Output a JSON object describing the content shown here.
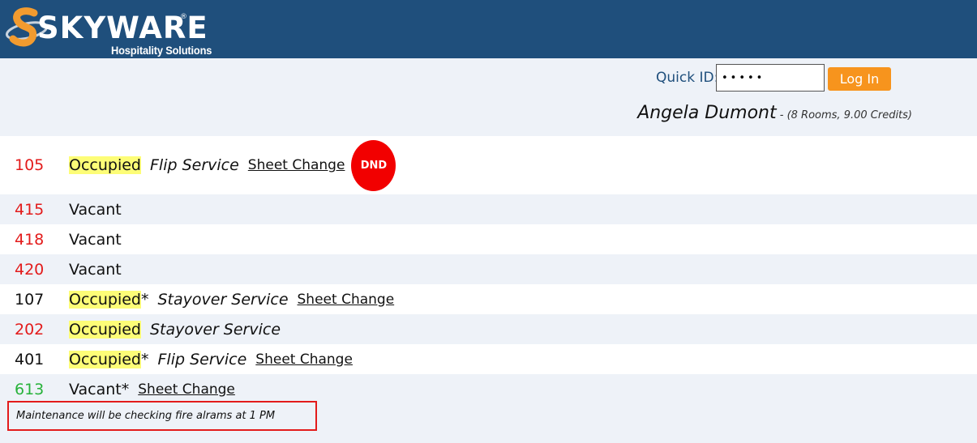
{
  "brand": {
    "name": "SKYWARE",
    "registered": "®",
    "tagline": "Hospitality Solutions",
    "colors": {
      "header": "#1f4f7c",
      "accent": "#f7941d"
    }
  },
  "login": {
    "label": "Quick ID:",
    "value": "•••••",
    "button_label": "Log In"
  },
  "user": {
    "name": "Angela Dumont",
    "meta": " - (8 Rooms, 9.00 Credits)"
  },
  "rooms": [
    {
      "number": "105",
      "status": "Occupied",
      "service": "Flip Service",
      "sheet": "Sheet Change",
      "badge": "DND"
    },
    {
      "number": "415",
      "status": "Vacant"
    },
    {
      "number": "418",
      "status": "Vacant"
    },
    {
      "number": "420",
      "status": "Vacant"
    },
    {
      "number": "107",
      "status": "Occupied*",
      "service": "Stayover Service",
      "sheet": "Sheet Change"
    },
    {
      "number": "202",
      "status": "Occupied",
      "service": "Stayover Service"
    },
    {
      "number": "401",
      "status": "Occupied*",
      "service": "Flip Service",
      "sheet": "Sheet Change"
    },
    {
      "number": "613",
      "status": "Vacant*",
      "sheet": "Sheet Change"
    }
  ],
  "note": "Maintenance will be checking fire alrams at 1 PM"
}
